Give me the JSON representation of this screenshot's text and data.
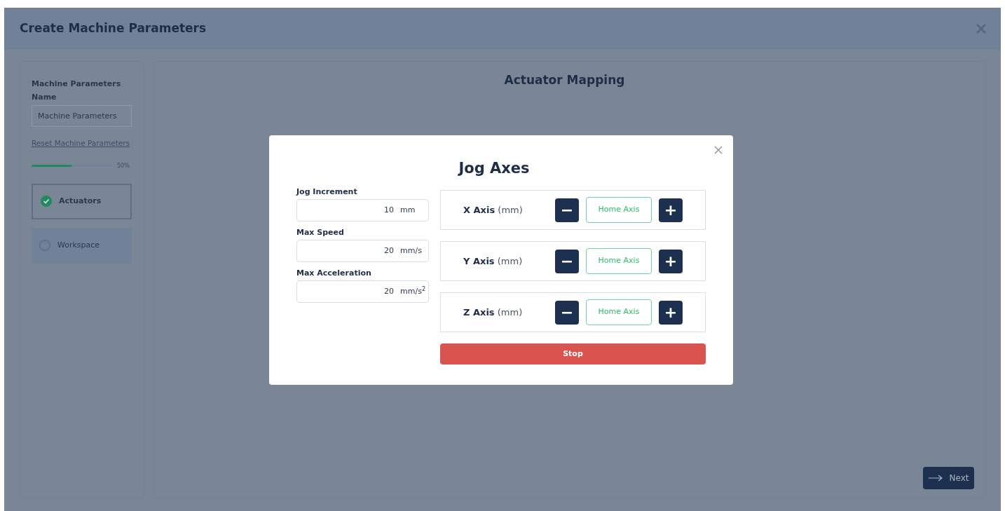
{
  "window": {
    "title": "Create Machine Parameters"
  },
  "sidebar": {
    "name_label": "Machine Parameters Name",
    "name_value": "Machine Parameters",
    "reset_link": "Reset Machine Parameters",
    "progress": {
      "level": 0.5,
      "reading": "50%"
    },
    "steps": [
      {
        "label": "Actuators",
        "checked": true,
        "selected": true
      },
      {
        "label": "Workspace",
        "checked": false,
        "selected": false
      }
    ]
  },
  "main": {
    "title": "Actuator Mapping",
    "next_button": "Next"
  },
  "dialog": {
    "title": "Jog Axes",
    "fields": [
      {
        "label": "Jog Increment",
        "value": "10",
        "unit": "mm"
      },
      {
        "label": "Max Speed",
        "value": "20",
        "unit": "mm/s"
      },
      {
        "label": "Max Acceleration",
        "value": "20",
        "unit": "mm/s$^{2}$"
      }
    ],
    "axes": [
      {
        "name": "X Axis",
        "unit": "(mm)",
        "minus": "−",
        "home": "Home Axis",
        "plus": "+"
      },
      {
        "name": "Y Axis",
        "unit": "(mm)",
        "minus": "−",
        "home": "Home Axis",
        "plus": "+"
      },
      {
        "name": "Z Axis",
        "unit": "(mm)",
        "minus": "−",
        "home": "Home Axis",
        "plus": "+"
      }
    ],
    "stop_button": "Stop"
  }
}
